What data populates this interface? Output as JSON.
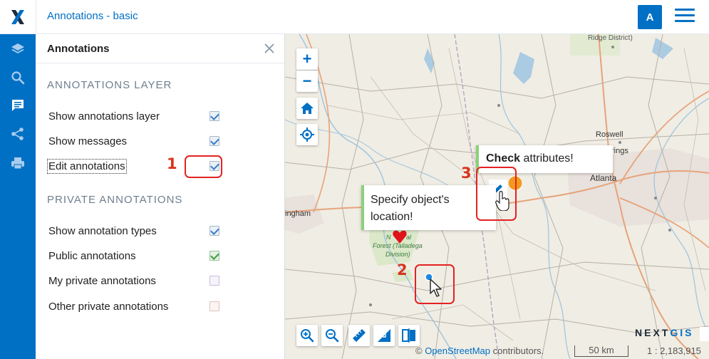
{
  "header": {
    "title": "Annotations - basic",
    "avatar_letter": "A",
    "logo_icon": "nextgis-x-logo"
  },
  "rail": {
    "items": [
      {
        "icon": "layers-icon",
        "active": false
      },
      {
        "icon": "search-icon",
        "active": false
      },
      {
        "icon": "annotation-icon",
        "active": true
      },
      {
        "icon": "share-icon",
        "active": false
      },
      {
        "icon": "print-icon",
        "active": false
      }
    ]
  },
  "panel": {
    "title": "Annotations",
    "annotations_layer": {
      "heading": "ANNOTATIONS LAYER",
      "options": [
        {
          "label": "Show annotations layer",
          "checked": true
        },
        {
          "label": "Show messages",
          "checked": true
        },
        {
          "label": "Edit annotations",
          "checked": true
        }
      ]
    },
    "private_annotations": {
      "heading": "PRIVATE ANNOTATIONS",
      "options": [
        {
          "label": "Show annotation types",
          "checked": true
        },
        {
          "label": "Public annotations",
          "checked": true
        },
        {
          "label": "My private annotations",
          "checked": false
        },
        {
          "label": "Other private annotations",
          "checked": false
        }
      ]
    }
  },
  "map": {
    "labels": {
      "ridge": "Ridge District)",
      "roswell": "Roswell",
      "springs": "rings",
      "atlanta": "Atlanta",
      "birmingham": "ingham",
      "forest_1": "N",
      "forest_2": "al",
      "forest_3": "Forest (Talladega",
      "forest_4": "Division)"
    },
    "popups": {
      "check_bold": "Check",
      "check_rest": " attributes!",
      "specify_line1": "Specify object's",
      "specify_line2": "location!"
    },
    "brand_prefix": "NEXT",
    "brand_suffix": "GIS",
    "attribution_symbol": "©",
    "attribution_link": "OpenStreetMap",
    "attribution_rest": " contributors.",
    "scale_label": "50 km",
    "scale_ratio": "1 : 2,183,915",
    "accent_color": "#0070c5"
  },
  "callouts": [
    "1",
    "2",
    "3"
  ]
}
